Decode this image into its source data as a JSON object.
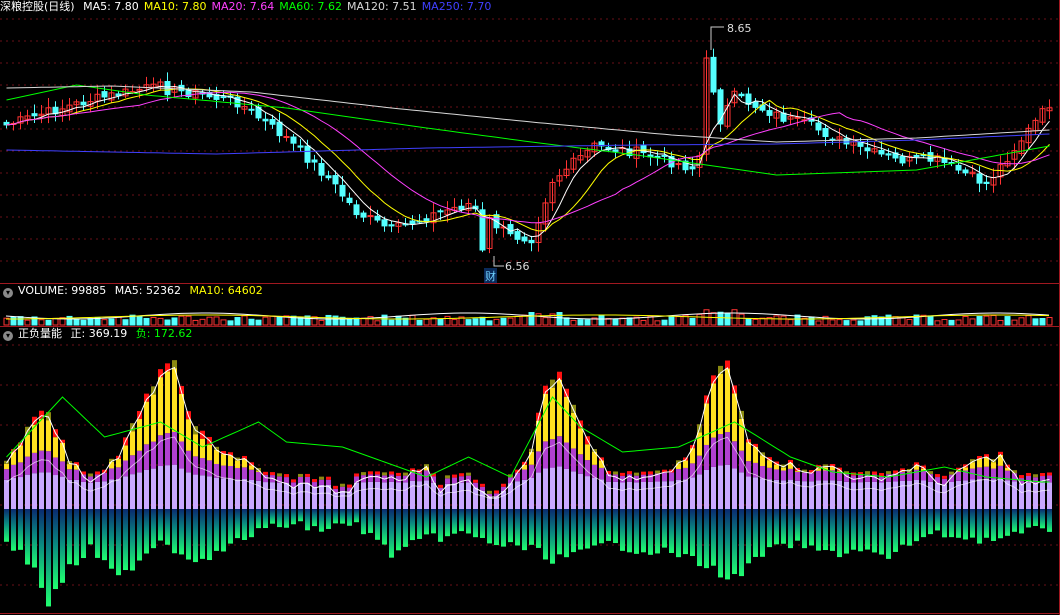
{
  "main": {
    "name": "深粮控股(日线)",
    "ma": [
      {
        "label": "MA5: 7.80",
        "color": "#ffffff"
      },
      {
        "label": "MA10: 7.80",
        "color": "#ffff00"
      },
      {
        "label": "MA20: 7.64",
        "color": "#ff40ff"
      },
      {
        "label": "MA60: 7.62",
        "color": "#00ff00"
      },
      {
        "label": "MA120: 7.51",
        "color": "#d8d8d8"
      },
      {
        "label": "MA250: 7.70",
        "color": "#4040ff"
      }
    ],
    "high_label": "8.65",
    "low_label": "6.56",
    "fin_marker": "财"
  },
  "volume": {
    "title": "VOLUME: 99885",
    "ma5": "MA5: 52362",
    "ma10": "MA10: 64602"
  },
  "indicator": {
    "name": "正负量能",
    "pos": "正: 369.19",
    "neg": "负: 172.62"
  },
  "colors": {
    "up": "#ff3333",
    "down": "#54ffff",
    "ma5": "#ffffff",
    "ma10": "#ffff00",
    "ma20": "#ff40ff",
    "ma60": "#00ff00",
    "ma120": "#d8d8d8",
    "ma250": "#4040ff",
    "separator": "#a01820"
  },
  "icons": {
    "collapse": "chevron-down-icon"
  }
}
